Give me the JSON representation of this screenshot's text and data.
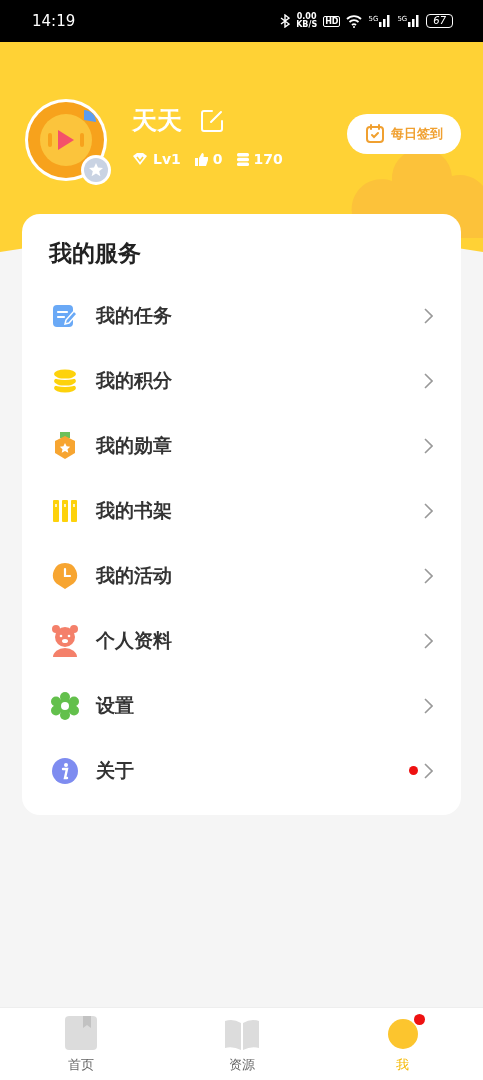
{
  "status_bar": {
    "time": "14:19",
    "speed": "0.00",
    "speed_unit": "KB/S",
    "hd": "HD",
    "sim1": "5G",
    "sim2": "5G",
    "battery": "67"
  },
  "profile": {
    "name": "天天",
    "level": "Lv1",
    "likes": "0",
    "points": "170",
    "checkin_button": "每日签到"
  },
  "services": {
    "title": "我的服务",
    "items": [
      {
        "label": "我的任务",
        "dot": false
      },
      {
        "label": "我的积分",
        "dot": false
      },
      {
        "label": "我的勋章",
        "dot": false
      },
      {
        "label": "我的书架",
        "dot": false
      },
      {
        "label": "我的活动",
        "dot": false
      },
      {
        "label": "个人资料",
        "dot": false
      },
      {
        "label": "设置",
        "dot": false
      },
      {
        "label": "关于",
        "dot": true
      }
    ]
  },
  "tabs": [
    {
      "label": "首页",
      "selected": false
    },
    {
      "label": "资源",
      "selected": false
    },
    {
      "label": "我",
      "selected": true,
      "dot": true
    }
  ]
}
